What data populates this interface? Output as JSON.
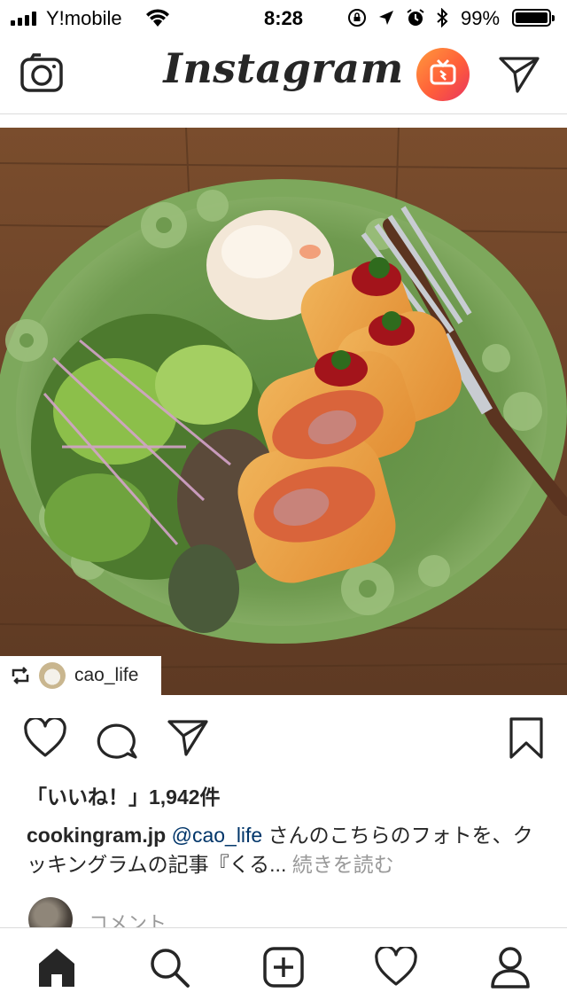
{
  "status_bar": {
    "carrier": "Y!mobile",
    "time": "8:28",
    "battery_percent": "99%"
  },
  "nav": {
    "logo": "Instagram",
    "icons": [
      "camera-icon",
      "igtv-icon",
      "direct-message-icon"
    ],
    "igtv_gradient": [
      "#ff9a3c",
      "#e8345f"
    ]
  },
  "post": {
    "repost_username": "cao_life",
    "likes_text": "「いいね！」1,942件",
    "caption_user": "cookingram.jp",
    "caption_mention": "@cao_life",
    "caption_text": " さんのこちらのフォトを、クッキングラムの記事『くる... ",
    "caption_more": "続きを読む",
    "comment_placeholder": "コメント..."
  },
  "actions": [
    "heart-icon",
    "comment-icon",
    "share-icon",
    "bookmark-icon"
  ],
  "tab_bar": [
    "home-icon",
    "search-icon",
    "add-post-icon",
    "activity-icon",
    "profile-icon"
  ],
  "colors": {
    "mention": "#003569",
    "muted": "#999999",
    "plate": "#6f9a4f",
    "table": "#6b4228"
  }
}
